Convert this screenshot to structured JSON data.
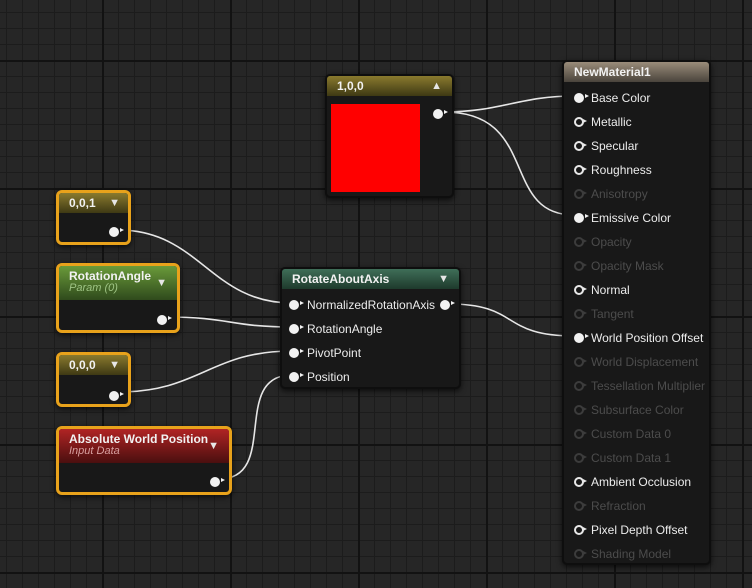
{
  "nodes": {
    "color_constant": {
      "title": "1,0,0",
      "swatch_color": "#ff0000"
    },
    "vector_001": {
      "title": "0,0,1"
    },
    "rotation_angle": {
      "title": "RotationAngle",
      "subtitle": "Param (0)"
    },
    "vector_000": {
      "title": "0,0,0"
    },
    "abs_world_pos": {
      "title": "Absolute World Position",
      "subtitle": "Input Data"
    },
    "rotate_about_axis": {
      "title": "RotateAboutAxis",
      "inputs": [
        "NormalizedRotationAxis",
        "RotationAngle",
        "PivotPoint",
        "Position"
      ]
    },
    "material": {
      "title": "NewMaterial1",
      "inputs": [
        {
          "label": "Base Color",
          "state": "connected"
        },
        {
          "label": "Metallic",
          "state": "open"
        },
        {
          "label": "Specular",
          "state": "open"
        },
        {
          "label": "Roughness",
          "state": "open"
        },
        {
          "label": "Anisotropy",
          "state": "disabled"
        },
        {
          "label": "Emissive Color",
          "state": "connected"
        },
        {
          "label": "Opacity",
          "state": "disabled"
        },
        {
          "label": "Opacity Mask",
          "state": "disabled"
        },
        {
          "label": "Normal",
          "state": "open"
        },
        {
          "label": "Tangent",
          "state": "disabled"
        },
        {
          "label": "World Position Offset",
          "state": "connected"
        },
        {
          "label": "World Displacement",
          "state": "disabled"
        },
        {
          "label": "Tessellation Multiplier",
          "state": "disabled"
        },
        {
          "label": "Subsurface Color",
          "state": "disabled"
        },
        {
          "label": "Custom Data 0",
          "state": "disabled"
        },
        {
          "label": "Custom Data 1",
          "state": "disabled"
        },
        {
          "label": "Ambient Occlusion",
          "state": "open"
        },
        {
          "label": "Refraction",
          "state": "disabled"
        },
        {
          "label": "Pixel Depth Offset",
          "state": "open"
        },
        {
          "label": "Shading Model",
          "state": "disabled"
        }
      ]
    }
  },
  "icons": {
    "collapse": "triangle-down-icon",
    "expand": "triangle-up-icon"
  },
  "colors": {
    "selection_border": "#e8a21b",
    "wire": "#e6e6e6",
    "background": "#262626"
  }
}
